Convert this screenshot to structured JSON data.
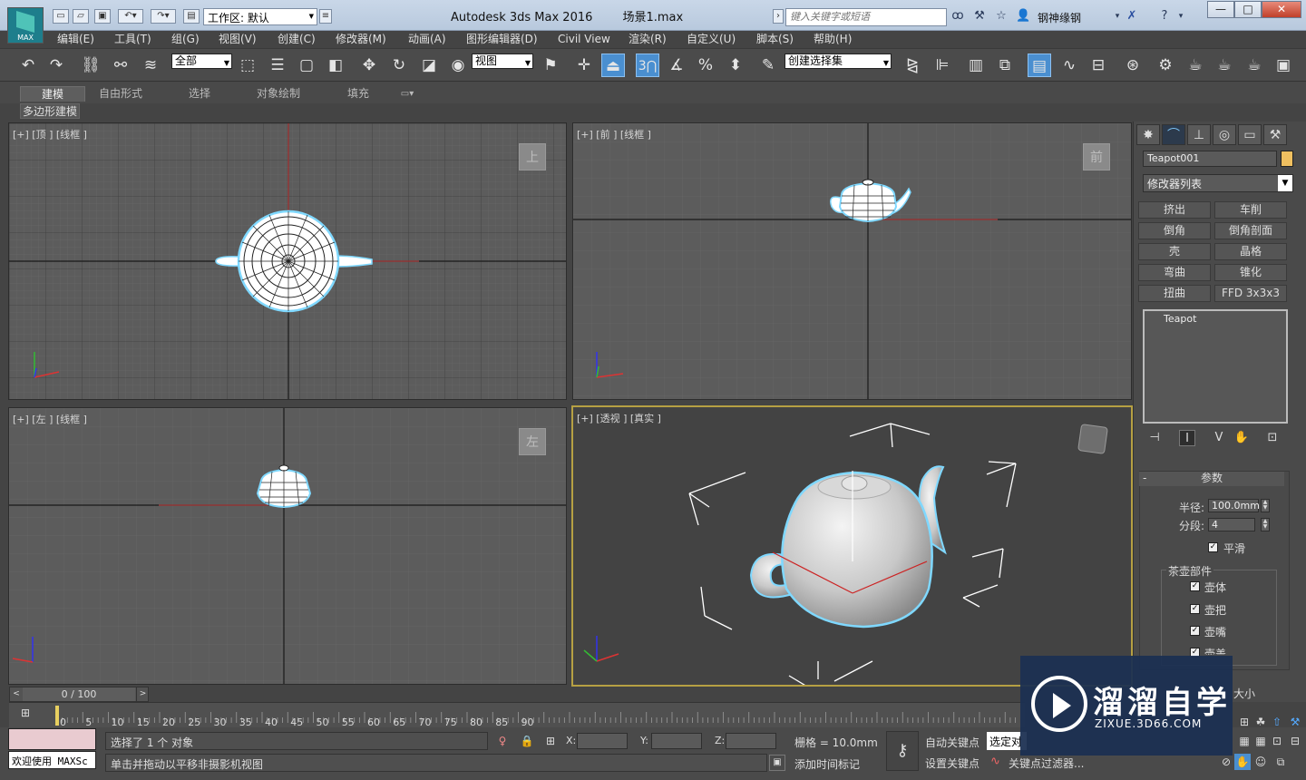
{
  "window": {
    "app_logo_label": "MAX",
    "title": "Autodesk 3ds Max 2016        场景1.max",
    "workspace": "工作区: 默认",
    "search_placeholder": "键入关键字或短语",
    "user_name": "钢神缘钢",
    "min_label": "—",
    "max_label": "□",
    "close_label": "✕"
  },
  "menu": [
    "编辑(E)",
    "工具(T)",
    "组(G)",
    "视图(V)",
    "创建(C)",
    "修改器(M)",
    "动画(A)",
    "图形编辑器(D)",
    "Civil View",
    "渲染(R)",
    "自定义(U)",
    "脚本(S)",
    "帮助(H)"
  ],
  "toolbar": {
    "selection_filter": "全部",
    "ref_coord": "视图",
    "named_selection": "创建选择集",
    "snap_label": "3"
  },
  "ribbon": {
    "tabs": [
      "建模",
      "自由形式",
      "选择",
      "对象绘制",
      "填充"
    ],
    "panel_label": "多边形建模"
  },
  "viewports": {
    "top": {
      "label": "[+] [顶 ] [线框 ]",
      "cube": "上"
    },
    "front": {
      "label": "[+] [前 ] [线框 ]",
      "cube": "前"
    },
    "left": {
      "label": "[+] [左 ] [线框 ]",
      "cube": "左"
    },
    "persp": {
      "label": "[+] [透视 ] [真实 ]"
    }
  },
  "command_panel": {
    "object_name": "Teapot001",
    "object_color": "#f0c060",
    "modifier_list": "修改器列表",
    "modifier_buttons": [
      "挤出",
      "车削",
      "倒角",
      "倒角剖面",
      "壳",
      "晶格",
      "弯曲",
      "锥化",
      "扭曲",
      "FFD 3x3x3"
    ],
    "stack_item": "Teapot",
    "params_title": "参数",
    "radius_label": "半径:",
    "radius_value": "100.0mm",
    "segments_label": "分段:",
    "segments_value": "4",
    "smooth_label": "平滑",
    "parts_group_label": "茶壶部件",
    "parts": [
      "壶体",
      "壶把",
      "壶嘴",
      "壶盖"
    ],
    "partial_label": "大小"
  },
  "timeline": {
    "frame_label": "0 / 100",
    "ticks": [
      "0",
      "5",
      "10",
      "15",
      "20",
      "25",
      "30",
      "35",
      "40",
      "45",
      "50",
      "55",
      "60",
      "65",
      "70",
      "75",
      "80",
      "85",
      "90"
    ]
  },
  "status": {
    "welcome": "欢迎使用 MAXSc",
    "selection": "选择了 1 个 对象",
    "prompt": "单击并拖动以平移非摄影机视图",
    "x_label": "X:",
    "y_label": "Y:",
    "z_label": "Z:",
    "grid": "栅格 = 10.0mm",
    "add_time_tag": "添加时间标记",
    "auto_key": "自动关键点",
    "set_key": "设置关键点",
    "selected_filter": "选定对",
    "key_filters": "关键点过滤器..."
  },
  "watermark": {
    "title": "溜溜自学",
    "url": "ZIXUE.3D66.COM"
  }
}
